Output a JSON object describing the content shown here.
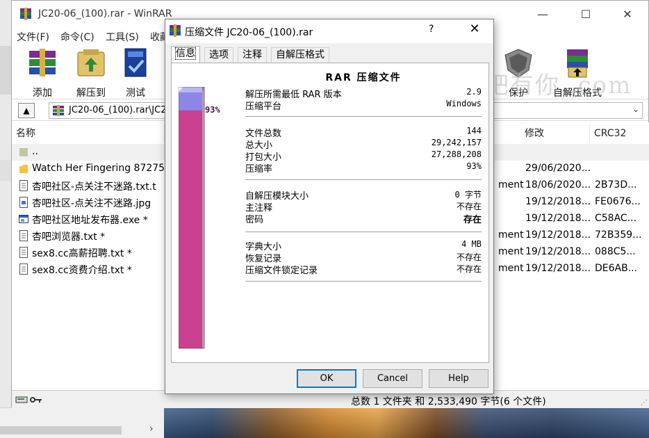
{
  "main_window": {
    "title": "JC20-06_(100).rar - WinRAR",
    "menu": [
      "文件(F)",
      "命令(C)",
      "工具(S)",
      "收藏"
    ],
    "toolbar": [
      {
        "label": "添加",
        "icon": "add-icon"
      },
      {
        "label": "解压到",
        "icon": "extract-to-icon"
      },
      {
        "label": "测试",
        "icon": "test-icon"
      },
      {
        "label": "保护",
        "icon": "protect-icon"
      },
      {
        "label": "自解压格式",
        "icon": "sfx-icon"
      }
    ],
    "address": "JC20-06_(100).rar\\JC2",
    "columns": {
      "name": "名称",
      "modified": "修改",
      "crc": "CRC32"
    },
    "files": [
      {
        "name": "..",
        "type_fragment": "",
        "modified": "",
        "crc": "",
        "icon": "parent-folder-icon"
      },
      {
        "name": "Watch Her Fingering 87275",
        "type_fragment": "",
        "modified": "29/06/2020...",
        "crc": "",
        "icon": "folder-icon"
      },
      {
        "name": "杏吧社区-点关注不迷路.txt.t",
        "type_fragment": "ment",
        "modified": "18/06/2020...",
        "crc": "2B73D...",
        "icon": "text-file-icon"
      },
      {
        "name": "杏吧社区-点关注不迷路.jpg",
        "type_fragment": "",
        "modified": "19/12/2018...",
        "crc": "FE0676...",
        "icon": "image-file-icon"
      },
      {
        "name": "杏吧社区地址发布器.exe *",
        "type_fragment": "",
        "modified": "19/12/2018...",
        "crc": "C58AC...",
        "icon": "exe-file-icon"
      },
      {
        "name": "杏吧浏览器.txt *",
        "type_fragment": "ment",
        "modified": "19/12/2018...",
        "crc": "72B359...",
        "icon": "text-file-icon"
      },
      {
        "name": "sex8.cc高薪招聘.txt *",
        "type_fragment": "ment",
        "modified": "19/12/2018...",
        "crc": "088C5...",
        "icon": "text-file-icon"
      },
      {
        "name": "sex8.cc资费介绍.txt *",
        "type_fragment": "ment",
        "modified": "19/12/2018...",
        "crc": "DE6AB...",
        "icon": "text-file-icon"
      }
    ],
    "status": "总数 1 文件夹 和 2,533,490 字节(6 个文件)",
    "watermark": "杏吧有你 .com"
  },
  "dialog": {
    "title": "压缩文件 JC20-06_(100).rar",
    "help_glyph": "?",
    "tabs": [
      "信息",
      "选项",
      "注释",
      "自解压格式"
    ],
    "heading": "RAR 压缩文件",
    "gauge_percent": 93,
    "gauge_label": "93%",
    "group1": [
      {
        "label": "解压所需最低 RAR 版本",
        "value": "2.9"
      },
      {
        "label": "压缩平台",
        "value": "Windows"
      }
    ],
    "group2": [
      {
        "label": "文件总数",
        "value": "144"
      },
      {
        "label": "总大小",
        "value": "29,242,157"
      },
      {
        "label": "打包大小",
        "value": "27,288,208"
      },
      {
        "label": "压缩率",
        "value": "93%"
      }
    ],
    "group3": [
      {
        "label": "自解压模块大小",
        "value": "0 字节"
      },
      {
        "label": "主注释",
        "value": "不存在"
      },
      {
        "label": "密码",
        "value": "存在"
      }
    ],
    "group4": [
      {
        "label": "字典大小",
        "value": "4 MB"
      },
      {
        "label": "恢复记录",
        "value": "不存在"
      },
      {
        "label": "压缩文件锁定记录",
        "value": "不存在"
      }
    ],
    "buttons": {
      "ok": "OK",
      "cancel": "Cancel",
      "help": "Help"
    }
  },
  "colors": {
    "gauge_empty": "#8c86e6",
    "gauge_fill": "#c8408e",
    "accent": "#0078d7"
  }
}
